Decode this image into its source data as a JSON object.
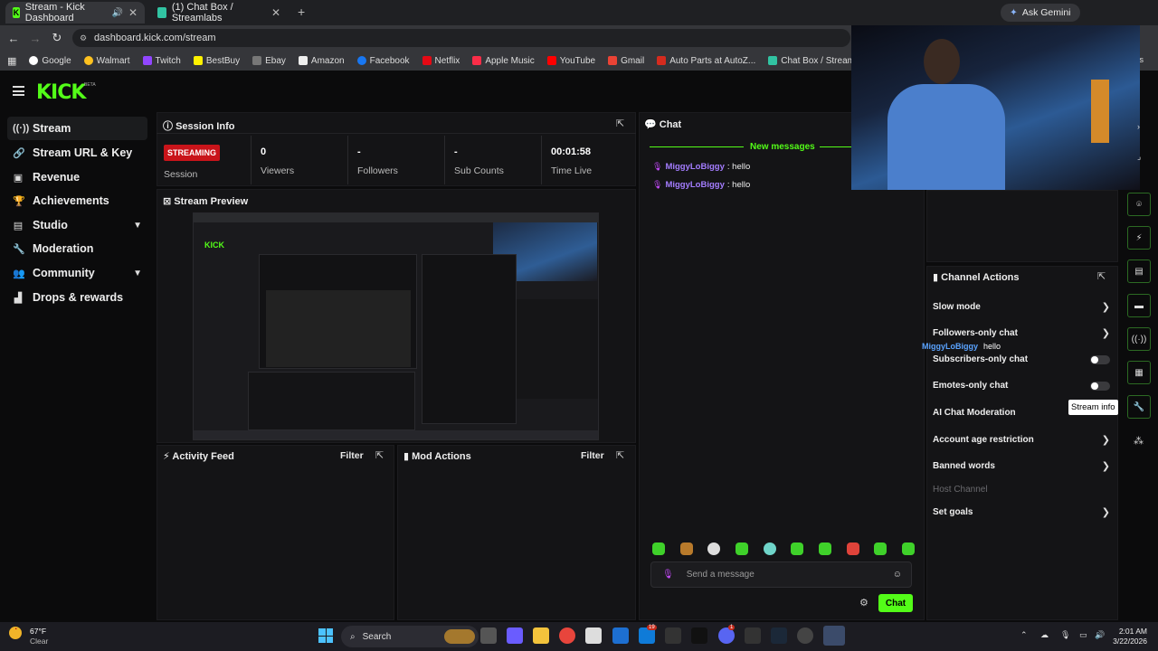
{
  "browser": {
    "tabs": [
      {
        "title": "Stream - Kick Dashboard"
      },
      {
        "title": "(1) Chat Box / Streamlabs"
      }
    ],
    "ask_gemini": "Ask Gemini",
    "url": "dashboard.kick.com/stream",
    "bookmarks": [
      "Google",
      "Walmart",
      "Twitch",
      "BestBuy",
      "Ebay",
      "Amazon",
      "Facebook",
      "Netflix",
      "Apple Music",
      "YouTube",
      "Gmail",
      "Auto Parts at AutoZ...",
      "Chat Box / Streamla..."
    ],
    "bookmarks_more": "rks"
  },
  "kick": {
    "logo": "KICK",
    "beta": "BETA"
  },
  "sidebar": {
    "items": [
      {
        "label": "Stream"
      },
      {
        "label": "Stream URL & Key"
      },
      {
        "label": "Revenue"
      },
      {
        "label": "Achievements"
      },
      {
        "label": "Studio"
      },
      {
        "label": "Moderation"
      },
      {
        "label": "Community"
      },
      {
        "label": "Drops & rewards"
      }
    ]
  },
  "session": {
    "title": "Session Info",
    "badge": "STREAMING",
    "session_label": "Session",
    "stats": [
      {
        "value": "0",
        "label": "Viewers"
      },
      {
        "value": "-",
        "label": "Followers"
      },
      {
        "value": "-",
        "label": "Sub Counts"
      },
      {
        "value": "00:01:58",
        "label": "Time Live"
      }
    ]
  },
  "preview": {
    "title": "Stream Preview"
  },
  "activity": {
    "title": "Activity Feed",
    "filter": "Filter"
  },
  "mod_actions": {
    "title": "Mod Actions",
    "filter": "Filter"
  },
  "chat": {
    "title": "Chat",
    "new_messages": "New messages",
    "messages": [
      {
        "user": "MiggyLoBiggy",
        "text": ": hello"
      },
      {
        "user": "MiggyLoBiggy",
        "text": ": hello"
      }
    ],
    "placeholder": "Send a message",
    "send": "Chat"
  },
  "overlay": {
    "user": "MiggyLoBiggy",
    "text": "hello"
  },
  "channel_actions": {
    "title": "Channel Actions",
    "rows": [
      {
        "label": "Slow mode"
      },
      {
        "label": "Followers-only chat"
      },
      {
        "label": "Subscribers-only chat"
      },
      {
        "label": "Emotes-only chat"
      },
      {
        "label": "AI Chat Moderation"
      },
      {
        "label": "Account age restriction"
      },
      {
        "label": "Banned words"
      },
      {
        "label": "Host Channel"
      },
      {
        "label": "Set goals"
      }
    ],
    "tooltip": "Stream info"
  },
  "taskbar": {
    "temp": "67°F",
    "weather": "Clear",
    "search": "Search",
    "time": "2:01 AM",
    "date": "3/22/2026",
    "notif_badge_1": "19",
    "notif_badge_2": "1"
  },
  "colors": {
    "kick_green": "#53fc18",
    "streaming_red": "#c9141a",
    "chat_name": "#a47dff"
  }
}
